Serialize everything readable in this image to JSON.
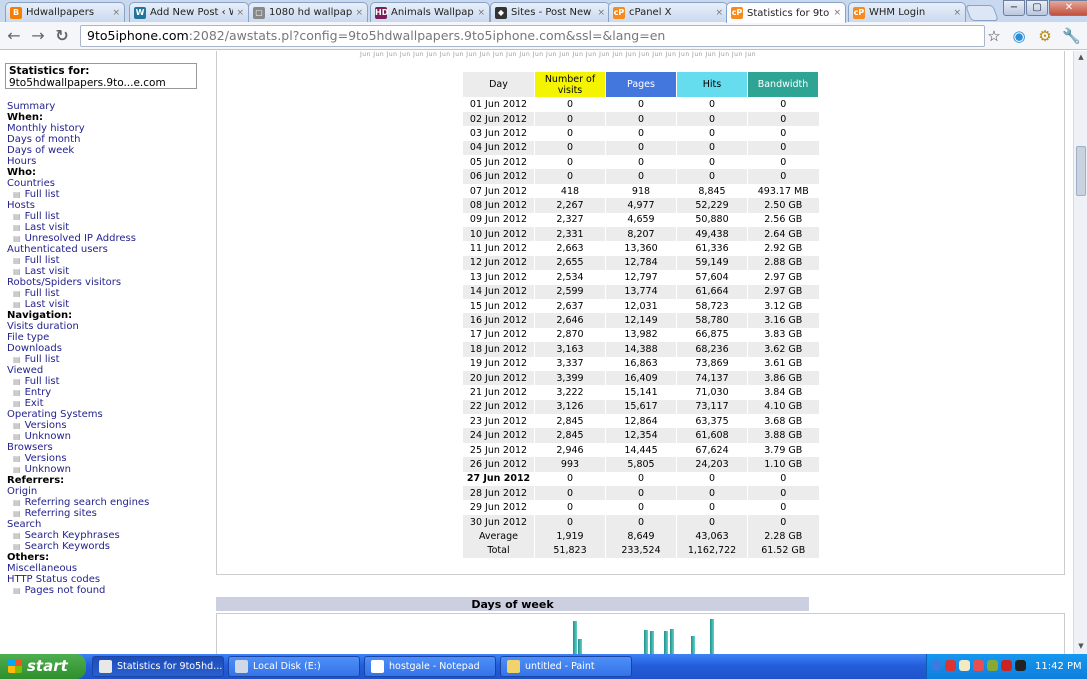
{
  "browser": {
    "tabs": [
      {
        "label": "Hdwallpapers",
        "icon": "blogger-icon",
        "active": false
      },
      {
        "label": "Add New Post ‹ Wa",
        "icon": "wordpress-icon",
        "active": false
      },
      {
        "label": "1080 hd wallpapers",
        "icon": "page-icon",
        "active": false
      },
      {
        "label": "Animals Wallpapers",
        "icon": "hd-icon",
        "active": false
      },
      {
        "label": "Sites - Post New Th",
        "icon": "sites-icon",
        "active": false
      },
      {
        "label": "cPanel X",
        "icon": "cpanel-icon",
        "active": false
      },
      {
        "label": "Statistics for 9to5h",
        "icon": "cpanel-icon",
        "active": true
      },
      {
        "label": "WHM Login",
        "icon": "cpanel-icon",
        "active": false
      }
    ],
    "tab_close_glyph": "×",
    "url_host": "9to5iphone.com",
    "url_rest": ":2082/awstats.pl?config=9to5hdwallpapers.9to5iphone.com&ssl=&lang=en"
  },
  "sidebar": {
    "stats_for_label": "Statistics for:",
    "stats_for_value": "9to5hdwallpapers.9to...e.com",
    "items": [
      {
        "t": "Summary",
        "k": "link"
      },
      {
        "t": "When:",
        "k": "hdr"
      },
      {
        "t": "Monthly history",
        "k": "link"
      },
      {
        "t": "Days of month",
        "k": "link"
      },
      {
        "t": "Days of week",
        "k": "link"
      },
      {
        "t": "Hours",
        "k": "link"
      },
      {
        "t": "Who:",
        "k": "hdr"
      },
      {
        "t": "Countries",
        "k": "link"
      },
      {
        "t": "Full list",
        "k": "sub"
      },
      {
        "t": "Hosts",
        "k": "link"
      },
      {
        "t": "Full list",
        "k": "sub"
      },
      {
        "t": "Last visit",
        "k": "sub"
      },
      {
        "t": "Unresolved IP Address",
        "k": "sub"
      },
      {
        "t": "Authenticated users",
        "k": "link"
      },
      {
        "t": "Full list",
        "k": "sub"
      },
      {
        "t": "Last visit",
        "k": "sub"
      },
      {
        "t": "Robots/Spiders visitors",
        "k": "link"
      },
      {
        "t": "Full list",
        "k": "sub"
      },
      {
        "t": "Last visit",
        "k": "sub"
      },
      {
        "t": "Navigation:",
        "k": "hdr"
      },
      {
        "t": "Visits duration",
        "k": "link"
      },
      {
        "t": "File type",
        "k": "link"
      },
      {
        "t": "Downloads",
        "k": "link"
      },
      {
        "t": "Full list",
        "k": "sub"
      },
      {
        "t": "Viewed",
        "k": "link"
      },
      {
        "t": "Full list",
        "k": "sub"
      },
      {
        "t": "Entry",
        "k": "sub"
      },
      {
        "t": "Exit",
        "k": "sub"
      },
      {
        "t": "Operating Systems",
        "k": "link"
      },
      {
        "t": "Versions",
        "k": "sub"
      },
      {
        "t": "Unknown",
        "k": "sub"
      },
      {
        "t": "Browsers",
        "k": "link"
      },
      {
        "t": "Versions",
        "k": "sub"
      },
      {
        "t": "Unknown",
        "k": "sub"
      },
      {
        "t": "Referrers:",
        "k": "hdr"
      },
      {
        "t": "Origin",
        "k": "link"
      },
      {
        "t": "Referring search engines",
        "k": "sub"
      },
      {
        "t": "Referring sites",
        "k": "sub"
      },
      {
        "t": "Search",
        "k": "link"
      },
      {
        "t": "Search Keyphrases",
        "k": "sub"
      },
      {
        "t": "Search Keywords",
        "k": "sub"
      },
      {
        "t": "Others:",
        "k": "hdr"
      },
      {
        "t": "Miscellaneous",
        "k": "link"
      },
      {
        "t": "HTTP Status codes",
        "k": "link"
      },
      {
        "t": "Pages not found",
        "k": "sub"
      }
    ]
  },
  "ruler_text": "Jun Jun Jun Jun Jun Jun Jun Jun Jun Jun Jun Jun Jun Jun Jun Jun Jun Jun Jun Jun Jun Jun Jun Jun Jun Jun Jun Jun Jun Jun",
  "days_table": {
    "headers": [
      {
        "label": "Day",
        "bg": "#ececec"
      },
      {
        "label": "Number of visits",
        "bg": "#f4f400"
      },
      {
        "label": "Pages",
        "bg": "#4477dd"
      },
      {
        "label": "Hits",
        "bg": "#66ddee"
      },
      {
        "label": "Bandwidth",
        "bg": "#2ea495"
      }
    ],
    "rows": [
      [
        "01 Jun 2012",
        "0",
        "0",
        "0",
        "0"
      ],
      [
        "02 Jun 2012",
        "0",
        "0",
        "0",
        "0"
      ],
      [
        "03 Jun 2012",
        "0",
        "0",
        "0",
        "0"
      ],
      [
        "04 Jun 2012",
        "0",
        "0",
        "0",
        "0"
      ],
      [
        "05 Jun 2012",
        "0",
        "0",
        "0",
        "0"
      ],
      [
        "06 Jun 2012",
        "0",
        "0",
        "0",
        "0"
      ],
      [
        "07 Jun 2012",
        "418",
        "918",
        "8,845",
        "493.17 MB"
      ],
      [
        "08 Jun 2012",
        "2,267",
        "4,977",
        "52,229",
        "2.50 GB"
      ],
      [
        "09 Jun 2012",
        "2,327",
        "4,659",
        "50,880",
        "2.56 GB"
      ],
      [
        "10 Jun 2012",
        "2,331",
        "8,207",
        "49,438",
        "2.64 GB"
      ],
      [
        "11 Jun 2012",
        "2,663",
        "13,360",
        "61,336",
        "2.92 GB"
      ],
      [
        "12 Jun 2012",
        "2,655",
        "12,784",
        "59,149",
        "2.88 GB"
      ],
      [
        "13 Jun 2012",
        "2,534",
        "12,797",
        "57,604",
        "2.97 GB"
      ],
      [
        "14 Jun 2012",
        "2,599",
        "13,774",
        "61,664",
        "2.97 GB"
      ],
      [
        "15 Jun 2012",
        "2,637",
        "12,031",
        "58,723",
        "3.12 GB"
      ],
      [
        "16 Jun 2012",
        "2,646",
        "12,149",
        "58,780",
        "3.16 GB"
      ],
      [
        "17 Jun 2012",
        "2,870",
        "13,982",
        "66,875",
        "3.83 GB"
      ],
      [
        "18 Jun 2012",
        "3,163",
        "14,388",
        "68,236",
        "3.62 GB"
      ],
      [
        "19 Jun 2012",
        "3,337",
        "16,863",
        "73,869",
        "3.61 GB"
      ],
      [
        "20 Jun 2012",
        "3,399",
        "16,409",
        "74,137",
        "3.86 GB"
      ],
      [
        "21 Jun 2012",
        "3,222",
        "15,141",
        "71,030",
        "3.84 GB"
      ],
      [
        "22 Jun 2012",
        "3,126",
        "15,617",
        "73,117",
        "4.10 GB"
      ],
      [
        "23 Jun 2012",
        "2,845",
        "12,864",
        "63,375",
        "3.68 GB"
      ],
      [
        "24 Jun 2012",
        "2,845",
        "12,354",
        "61,608",
        "3.88 GB"
      ],
      [
        "25 Jun 2012",
        "2,946",
        "14,445",
        "67,624",
        "3.79 GB"
      ],
      [
        "26 Jun 2012",
        "993",
        "5,805",
        "24,203",
        "1.10 GB"
      ],
      [
        "27 Jun 2012",
        "0",
        "0",
        "0",
        "0"
      ],
      [
        "28 Jun 2012",
        "0",
        "0",
        "0",
        "0"
      ],
      [
        "29 Jun 2012",
        "0",
        "0",
        "0",
        "0"
      ],
      [
        "30 Jun 2012",
        "0",
        "0",
        "0",
        "0"
      ]
    ],
    "current_day": "27 Jun 2012",
    "footer": [
      [
        "Average",
        "1,919",
        "8,649",
        "43,063",
        "2.28 GB"
      ],
      [
        "Total",
        "51,823",
        "233,524",
        "1,162,722",
        "61.52 GB"
      ]
    ]
  },
  "days_of_week": {
    "title": "Days of week",
    "bars": [
      0.95,
      0.55,
      0.15,
      0.75,
      0.72,
      0.72,
      0.78,
      0.62,
      1.0
    ]
  },
  "taskbar": {
    "start_label": "start",
    "tasks": [
      {
        "label": "Statistics for 9to5hd...",
        "icon": "chrome-icon",
        "active": true
      },
      {
        "label": "Local Disk (E:)",
        "icon": "drive-icon",
        "active": false
      },
      {
        "label": "hostgale - Notepad",
        "icon": "notepad-icon",
        "active": false
      },
      {
        "label": "untitled - Paint",
        "icon": "paint-icon",
        "active": false
      }
    ],
    "clock": "11:42 PM"
  }
}
